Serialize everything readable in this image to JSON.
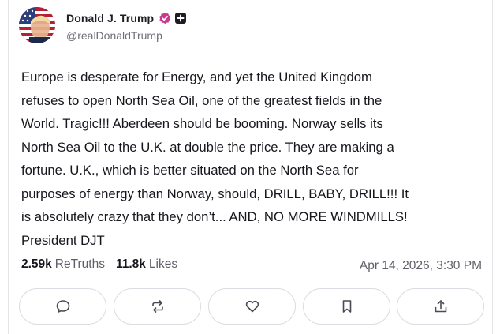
{
  "post": {
    "author_name": "Donald J. Trump",
    "handle": "@realDonaldTrump",
    "text": "Europe is desperate for Energy, and yet the United Kingdom\nrefuses to open North Sea Oil, one of the greatest fields in the\nWorld. Tragic!!! Aberdeen should be booming. Norway sells its\nNorth Sea Oil to the U.K. at double the price. They are making a\nfortune. U.K., which is better situated on the North Sea for\npurposes of energy than Norway, should, DRILL, BABY, DRILL!!! It\nis absolutely crazy that they don’t... AND, NO MORE WINDMILLS!\nPresident DJT",
    "retruths_count": "2.59k",
    "retruths_label": "ReTruths",
    "likes_count": "11.8k",
    "likes_label": "Likes",
    "timestamp": "Apr 14, 2026, 3:30 PM"
  },
  "badges": {
    "verified_icon": "verified-check-icon",
    "verified_color": "#c83a8f",
    "plus_icon": "plus-square-icon"
  },
  "actions": [
    {
      "icon": "reply-icon"
    },
    {
      "icon": "retruth-icon"
    },
    {
      "icon": "heart-icon"
    },
    {
      "icon": "bookmark-icon"
    },
    {
      "icon": "share-icon"
    }
  ],
  "colors": {
    "text": "#16161d",
    "muted": "#5f5f68",
    "border": "#dcdce2"
  }
}
